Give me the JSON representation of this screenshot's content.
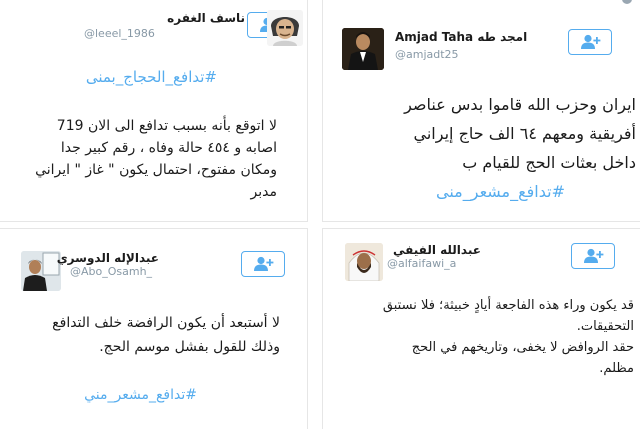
{
  "tweets": [
    {
      "position": "top-left",
      "display_name": "ناسف الغفره",
      "handle": "@leeel_1986",
      "hashtag": "#تدافع_الحجاج_بمنى",
      "text": "لا اتوقع بأنه بسبب تدافع الى الان 719\nاصابه و ٤٥٤ حالة وفاه ، رقم كبير جدا\nومكان مفتوح، احتمال يكون \" غاز \" ايراني\nمدبر",
      "avatar": "cartoon-man-avatar"
    },
    {
      "position": "top-right",
      "display_name": "Amjad Taha امجد طه",
      "handle": "@amjadt25",
      "text": "ايران وحزب الله قاموا بدس عناصر\nأفريقية ومعهم ٦٤ الف حاج إيراني\nداخل بعثات الحج للقيام ب",
      "hashtag": "#تدافع_مشعر_منى",
      "avatar": "man-in-suit-avatar"
    },
    {
      "position": "bottom-left",
      "display_name": "عبدالإله الدوسري",
      "handle": "@Abo_Osamh_",
      "text": "لا أستبعد أن يكون الرافضة خلف التدافع\nوذلك للقول بفشل موسم الحج.",
      "hashtag": "#تدافع_مشعر_مني",
      "avatar": "man-at-window-avatar"
    },
    {
      "position": "bottom-right",
      "display_name": "عبدالله الفيفي",
      "handle": "@alfaifawi_a",
      "text": "قد يكون وراء هذه الفاجعة أيادٍ خبيثة؛ فلا نستبق\nالتحقيقات.\nحقد الروافض لا يخفى، وتاريخهم في الحج\nمظلم.",
      "avatar": "sheikh-avatar"
    }
  ],
  "icons": {
    "follow": "add-user-icon",
    "follow_color": "#55acee"
  },
  "colors": {
    "hashtag": "#55acee",
    "handle": "#8899a6",
    "text": "#1b1b1b"
  }
}
